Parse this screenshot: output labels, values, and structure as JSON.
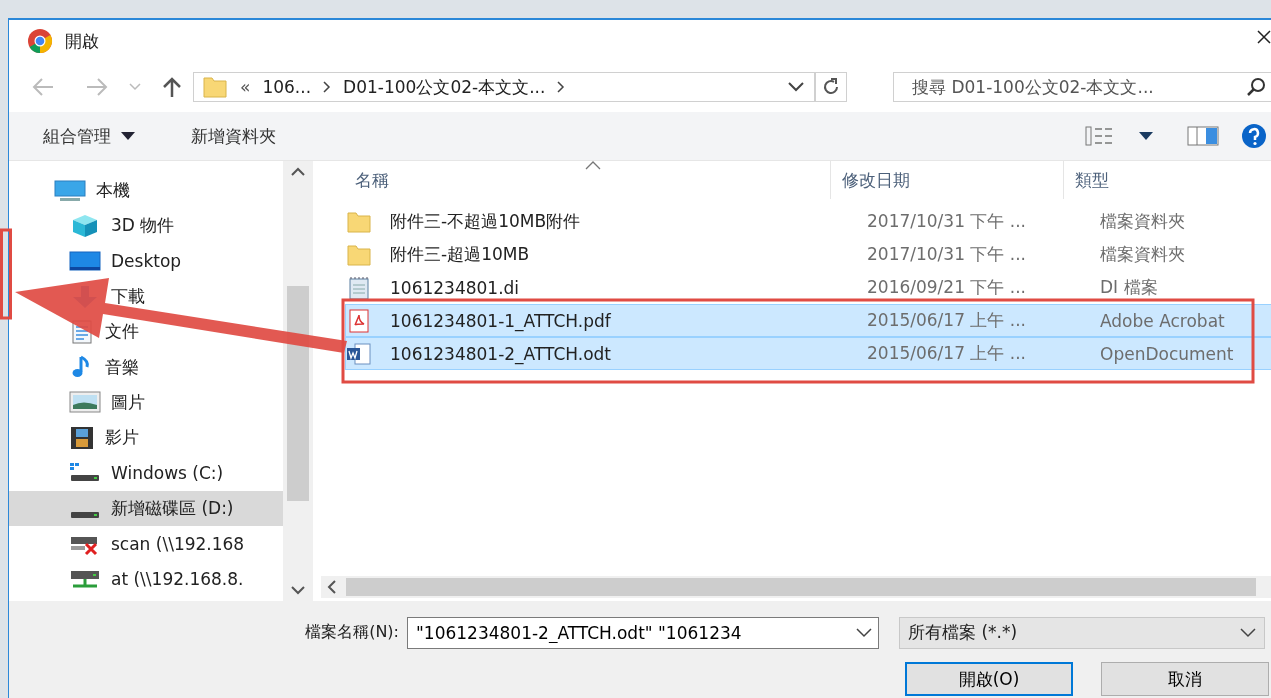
{
  "window": {
    "title": "開啟"
  },
  "address": {
    "overflow": "«",
    "crumbs": [
      "106...",
      "D01-100公文02-本文文..."
    ]
  },
  "search": {
    "placeholder": "搜尋 D01-100公文02-本文文..."
  },
  "toolbar": {
    "organize": "組合管理",
    "new_folder": "新增資料夾"
  },
  "sidebar": {
    "items": [
      {
        "label": "本機",
        "kind": "pc",
        "selected": false,
        "children": [
          {
            "label": "3D 物件",
            "kind": "cube",
            "selected": false
          },
          {
            "label": "Desktop",
            "kind": "desktop",
            "selected": false
          },
          {
            "label": "下載",
            "kind": "download",
            "selected": false
          },
          {
            "label": "文件",
            "kind": "document",
            "selected": false
          },
          {
            "label": "音樂",
            "kind": "music",
            "selected": false
          },
          {
            "label": "圖片",
            "kind": "pictures",
            "selected": false
          },
          {
            "label": "影片",
            "kind": "videos",
            "selected": false
          },
          {
            "label": "Windows (C:)",
            "kind": "system-drive",
            "selected": false
          },
          {
            "label": "新增磁碟區 (D:)",
            "kind": "drive",
            "selected": true
          },
          {
            "label": "scan (\\\\192.168",
            "kind": "net-off",
            "selected": false
          },
          {
            "label": "at (\\\\192.168.8.",
            "kind": "net",
            "selected": false
          }
        ]
      }
    ]
  },
  "columns": [
    "名稱",
    "修改日期",
    "類型"
  ],
  "files": [
    {
      "kind": "folder",
      "name": "附件三-不超過10MB附件",
      "date": "2017/10/31 下午 ...",
      "type": "檔案資料夾",
      "selected": false
    },
    {
      "kind": "folder",
      "name": "附件三-超過10MB",
      "date": "2017/10/31 下午 ...",
      "type": "檔案資料夾",
      "selected": false
    },
    {
      "kind": "text",
      "name": "1061234801.di",
      "date": "2016/09/21 下午 ...",
      "type": "DI 檔案",
      "selected": false
    },
    {
      "kind": "pdf",
      "name": "1061234801-1_ATTCH.pdf",
      "date": "2015/06/17 上午 ...",
      "type": "Adobe Acrobat",
      "selected": true
    },
    {
      "kind": "word",
      "name": "1061234801-2_ATTCH.odt",
      "date": "2015/06/17 上午 ...",
      "type": "OpenDocument",
      "selected": true
    }
  ],
  "footer": {
    "filename_label": "檔案名稱(N):",
    "filename": "\"1061234801-2_ATTCH.odt\" \"1061234",
    "filter": "所有檔案 (*.*)",
    "buttons": [
      {
        "label": "開啟(O)",
        "kind": "primary"
      },
      {
        "label": "取消",
        "kind": "secondary"
      }
    ]
  }
}
